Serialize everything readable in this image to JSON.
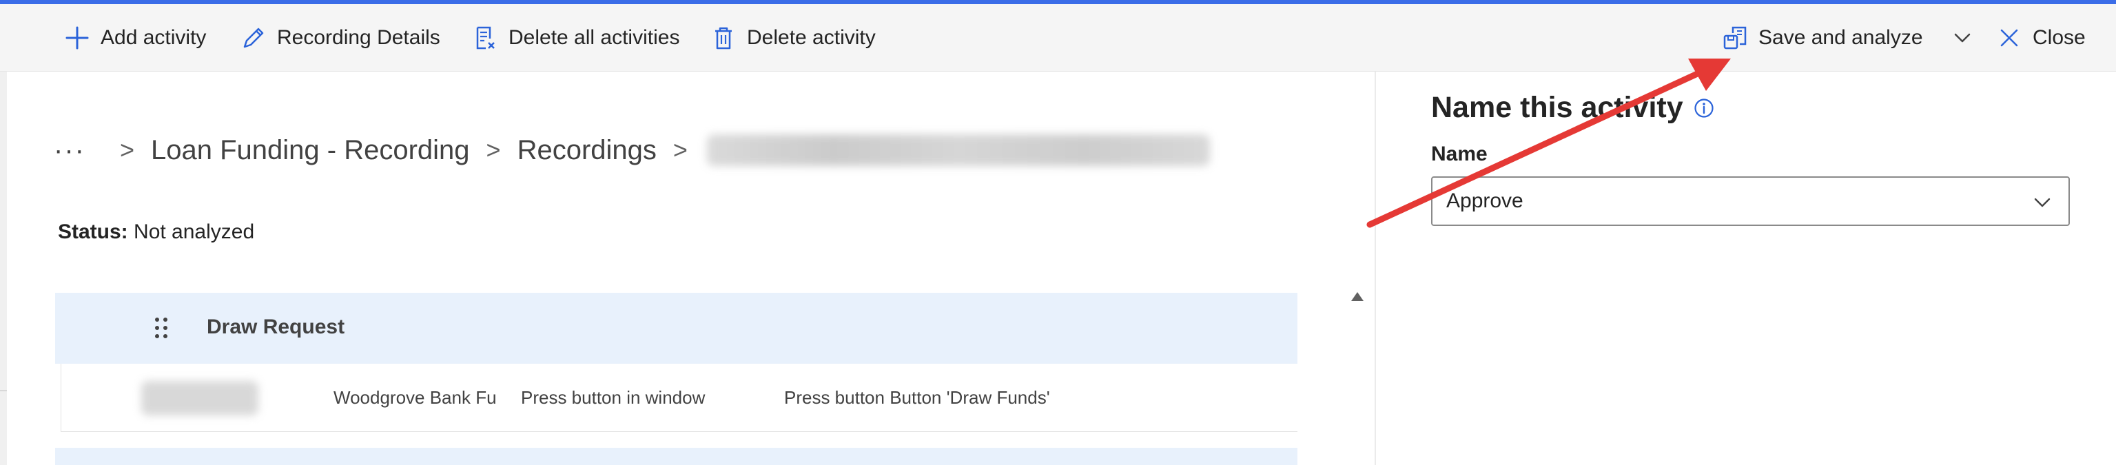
{
  "toolbar": {
    "add_activity": "Add activity",
    "recording_details": "Recording Details",
    "delete_all_activities": "Delete all activities",
    "delete_activity": "Delete activity",
    "save_and_analyze": "Save and analyze",
    "close": "Close"
  },
  "breadcrumb": {
    "more": "···",
    "items": [
      "Loan Funding - Recording",
      "Recordings"
    ],
    "separator": ">"
  },
  "status": {
    "label": "Status:",
    "value": "Not analyzed"
  },
  "activity_group": {
    "title": "Draw Request",
    "rows": [
      {
        "application": "Woodgrove Bank Fu",
        "action": "Press button in window",
        "description": "Press button Button 'Draw Funds'"
      }
    ]
  },
  "panel": {
    "title": "Name this activity",
    "name_label": "Name",
    "name_value": "Approve"
  },
  "colors": {
    "accent": "#3b6de8",
    "group_background": "#e8f1fc",
    "annotation_arrow": "#e53935"
  },
  "icons": {
    "add_activity": "plus-icon",
    "recording_details": "pencil-icon",
    "delete_all_activities": "document-delete-icon",
    "delete_activity": "trash-icon",
    "save_and_analyze": "save-analyze-icon",
    "save_dropdown": "chevron-down-icon",
    "close": "close-icon",
    "info": "info-icon",
    "drag": "drag-handle-icon",
    "scroll": "scroll-up-icon"
  }
}
